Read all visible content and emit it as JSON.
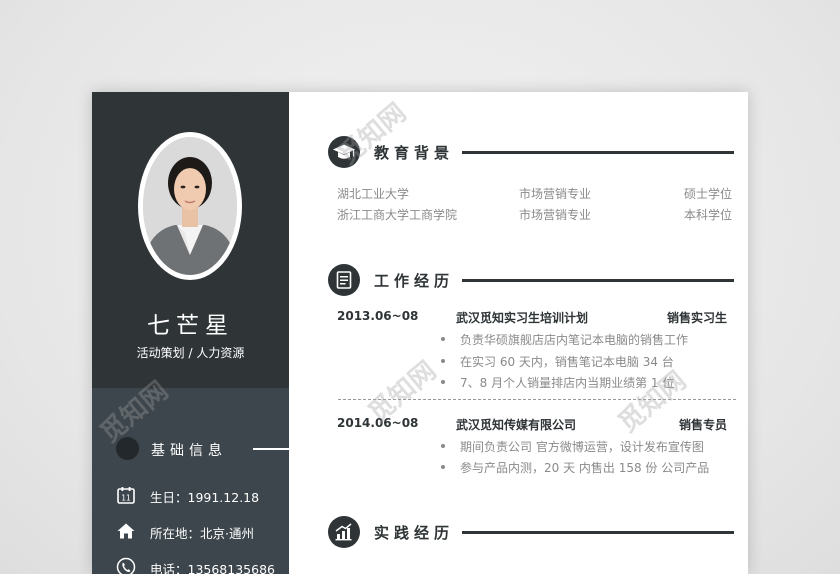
{
  "watermark": "觅知网",
  "profile": {
    "name": "七芒星",
    "role": "活动策划 / 人力资源"
  },
  "basic_info": {
    "title": "基础信息",
    "items": [
      {
        "icon": "calendar-icon",
        "text": "生日：1991.12.18"
      },
      {
        "icon": "home-icon",
        "text": "所在地：北京·通州"
      },
      {
        "icon": "phone-icon",
        "text": "电话：13568135686"
      }
    ]
  },
  "education": {
    "title": "教育背景",
    "icon": "graduation-cap-icon",
    "rows": [
      {
        "school": "湖北工业大学",
        "major": "市场营销专业",
        "degree": "硕士学位"
      },
      {
        "school": "浙江工商大学工商学院",
        "major": "市场营销专业",
        "degree": "本科学位"
      }
    ]
  },
  "work": {
    "title": "工作经历",
    "icon": "document-icon",
    "jobs": [
      {
        "date": "2013.06~08",
        "company": "武汉觅知实习生培训计划",
        "position": "销售实习生",
        "bullets": [
          "负责华硕旗舰店店内笔记本电脑的销售工作",
          "在实习 60 天内，销售笔记本电脑 34 台",
          "7、8 月个人销量排店内当期业绩第 1 位"
        ]
      },
      {
        "date": "2014.06~08",
        "company": "武汉觅知传媒有限公司",
        "position": "销售专员",
        "bullets": [
          "期间负责公司 官方微博运营，设计发布宣传图",
          "参与产品内测，20 天 内售出 158 份 公司产品"
        ]
      }
    ]
  },
  "practice": {
    "title": "实践经历",
    "icon": "chart-icon"
  },
  "colors": {
    "dark": "#2f3437",
    "sidebar_lower": "#3d464c",
    "muted_text": "#8a8a8a"
  }
}
